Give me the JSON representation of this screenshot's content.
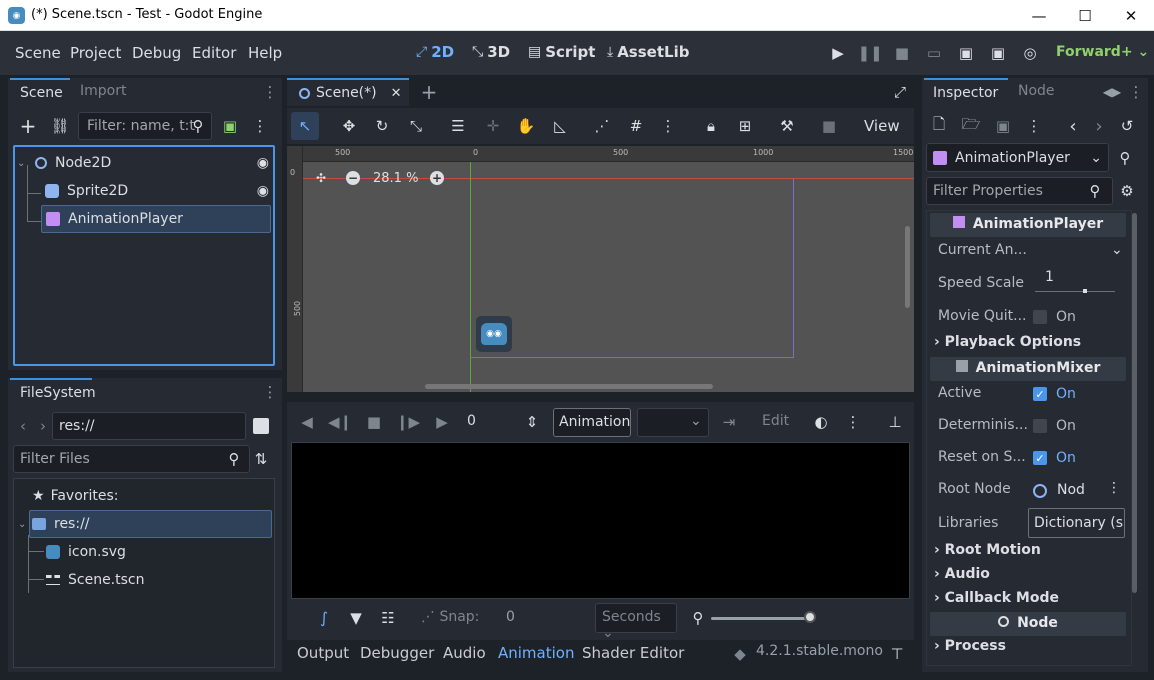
{
  "window": {
    "title": "(*) Scene.tscn - Test - Godot Engine",
    "minimize": "—",
    "maximize": "☐",
    "close": "✕"
  },
  "menu": {
    "items": [
      "Scene",
      "Project",
      "Debug",
      "Editor",
      "Help"
    ]
  },
  "workspaces": {
    "w2d": "2D",
    "w3d": "3D",
    "script": "Script",
    "assetlib": "AssetLib",
    "active": "2D"
  },
  "renderer": "Forward+",
  "scene_dock": {
    "tabs": [
      "Scene",
      "Import"
    ],
    "filter_placeholder": "Filter: name, t:t",
    "nodes": [
      "Node2D",
      "Sprite2D",
      "AnimationPlayer"
    ],
    "selected": "AnimationPlayer"
  },
  "filesystem": {
    "title": "FileSystem",
    "path": "res://",
    "filter_placeholder": "Filter Files",
    "items": [
      "Favorites:",
      "res://",
      "icon.svg",
      "Scene.tscn"
    ]
  },
  "editor": {
    "tab": "Scene(*)",
    "zoom": "28.1 %",
    "ruler_labels": [
      "500",
      "0",
      "500",
      "1000",
      "1500"
    ],
    "vruler_labels": [
      "0",
      "500"
    ],
    "view_label": "View"
  },
  "animation": {
    "time": "0",
    "animation_label": "Animation",
    "edit_label": "Edit",
    "snap_label": "Snap:",
    "snap_value": "0",
    "seconds_label": "Seconds"
  },
  "inspector": {
    "tabs": [
      "Inspector",
      "Node"
    ],
    "node_type": "AnimationPlayer",
    "filter_placeholder": "Filter Properties",
    "header1": "AnimationPlayer",
    "current_anim": "Current An...",
    "speed_scale_label": "Speed Scale",
    "speed_scale_value": "1",
    "movie_quit_label": "Movie Quit...",
    "movie_quit_value": "On",
    "playback_options": "Playback Options",
    "header2": "AnimationMixer",
    "active_label": "Active",
    "active_value": "On",
    "deterministic_label": "Determinis...",
    "deterministic_value": "On",
    "reset_label": "Reset on S...",
    "reset_value": "On",
    "root_node_label": "Root Node",
    "root_node_value": "Nod",
    "libraries_label": "Libraries",
    "libraries_value": "Dictionary (s",
    "root_motion": "Root Motion",
    "audio": "Audio",
    "callback_mode": "Callback Mode",
    "header3": "Node",
    "process": "Process",
    "checkbox_states": {
      "movie_quit": false,
      "active": true,
      "deterministic": false,
      "reset": true
    }
  },
  "bottom": {
    "tabs": [
      "Output",
      "Debugger",
      "Audio",
      "Animation",
      "Shader Editor"
    ],
    "active": "Animation",
    "version": "4.2.1.stable.mono"
  },
  "colors": {
    "accent": "#4a96e8",
    "selection": "#2f4159",
    "godot_blue": "#478cbf",
    "animation_purple": "#c38ef1"
  }
}
